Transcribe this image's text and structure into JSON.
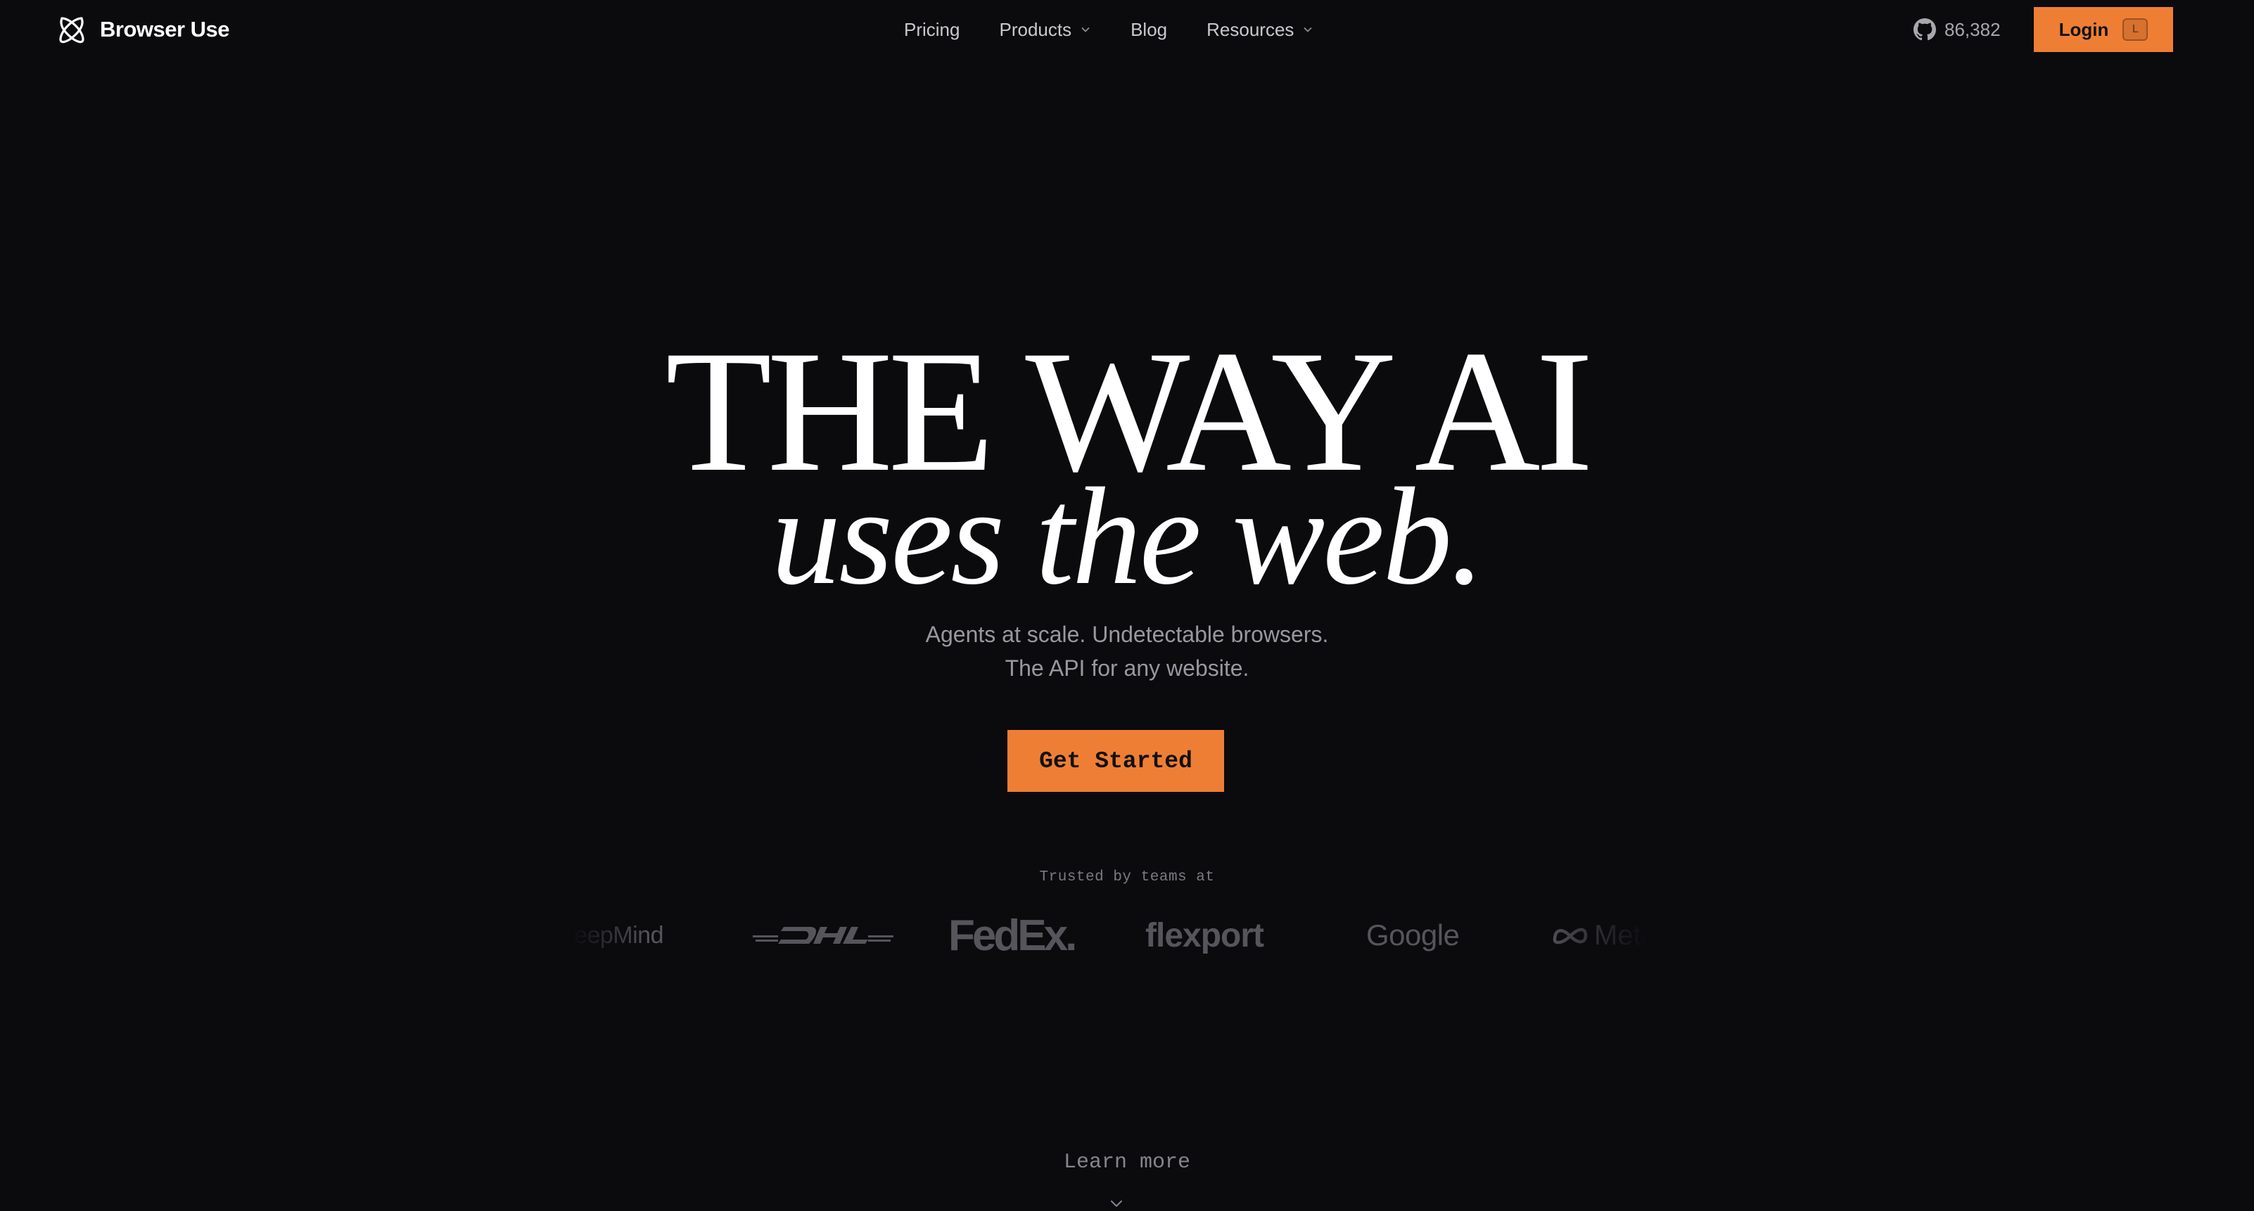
{
  "nav": {
    "brand": "Browser Use",
    "links": [
      {
        "label": "Pricing",
        "has_dropdown": false
      },
      {
        "label": "Products",
        "has_dropdown": true
      },
      {
        "label": "Blog",
        "has_dropdown": false
      },
      {
        "label": "Resources",
        "has_dropdown": true
      }
    ],
    "github_stars": "86,382",
    "login_label": "Login",
    "login_shortcut": "L"
  },
  "hero": {
    "line1": "THE WAY AI",
    "line2": "uses the web.",
    "subtitle_line1": "Agents at scale. Undetectable browsers.",
    "subtitle_line2": "The API for any website.",
    "cta_label": "Get Started"
  },
  "trusted": {
    "label": "Trusted by teams at",
    "logos": [
      "DeepMind",
      "DHL",
      "FedEx",
      "flexport",
      "Google",
      "Meta"
    ],
    "visible_text": {
      "deepmind": "DeepMind",
      "fedex_main": "FedEx",
      "fedex_dot": ".",
      "flexport": "flexport",
      "google": "Google",
      "meta": "Meta"
    }
  },
  "footer": {
    "learn_more": "Learn more"
  },
  "colors": {
    "background": "#0b0b0e",
    "accent": "#ef7e35",
    "text_primary": "#ffffff",
    "text_muted": "#98989f",
    "logo_gray": "#55555b"
  },
  "icons": {
    "brand": "browser-use-logo-icon",
    "dropdown": "chevron-down-icon",
    "github": "github-icon",
    "learn_more": "chevron-down-icon"
  }
}
